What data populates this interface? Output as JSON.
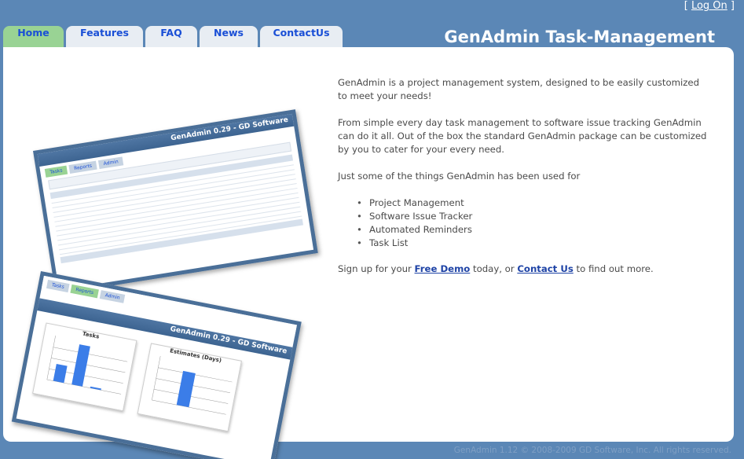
{
  "auth": {
    "bracket_open": "[",
    "logon_label": "Log On",
    "bracket_close": "]"
  },
  "nav": {
    "tabs": [
      {
        "label": "Home",
        "active": true
      },
      {
        "label": "Features",
        "active": false
      },
      {
        "label": "FAQ",
        "active": false
      },
      {
        "label": "News",
        "active": false
      },
      {
        "label": "ContactUs",
        "active": false
      }
    ]
  },
  "site_title": "GenAdmin Task-Management",
  "main": {
    "intro": "GenAdmin is a project management system, designed to be easily customized to meet your needs!",
    "description": "From simple every day task management to software issue tracking GenAdmin can do it all. Out of the box the standard GenAdmin package can be customized by you to cater for your every need.",
    "uses_heading": "Just some of the things GenAdmin has been used for",
    "uses": [
      "Project Management",
      "Software Issue Tracker",
      "Automated Reminders",
      "Task List"
    ],
    "cta_prefix": "Sign up for your ",
    "cta_demo_link": "Free Demo",
    "cta_middle": " today, or ",
    "cta_contact_link": "Contact Us",
    "cta_suffix": " to find out more."
  },
  "screenshots": {
    "shot1_title": "GenAdmin 0.29 - GD Software",
    "shot1_tabs": [
      "Tasks",
      "Reports",
      "Admin"
    ],
    "shot2_title": "GenAdmin 0.29 - GD Software",
    "shot2_tabs": [
      "Tasks",
      "Reports",
      "Admin"
    ],
    "chart1_title": "Tasks",
    "chart2_title": "Estimates (Days)"
  },
  "footer": "GenAdmin 1.12 © 2008-2009 GD Software, Inc. All rights reserved.",
  "colors": {
    "background": "#5b87b6",
    "active_tab": "#99d394",
    "tab": "#e8edf3",
    "link": "#1e43a6"
  }
}
